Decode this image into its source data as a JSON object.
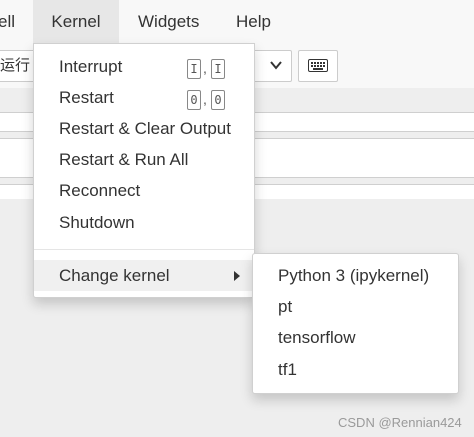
{
  "menubar": {
    "items": [
      {
        "label": "ell"
      },
      {
        "label": "Kernel"
      },
      {
        "label": "Widgets"
      },
      {
        "label": "Help"
      }
    ]
  },
  "toolbar": {
    "run_label": "运行",
    "keyboard_icon": "keyboard-icon",
    "chevron_icon": "chevron-down-icon"
  },
  "kernel_menu": {
    "interrupt": {
      "label": "Interrupt",
      "shortcut": [
        "I",
        "I"
      ]
    },
    "restart": {
      "label": "Restart",
      "shortcut": [
        "0",
        "0"
      ]
    },
    "restart_clear": {
      "label": "Restart & Clear Output"
    },
    "restart_run_all": {
      "label": "Restart & Run All"
    },
    "reconnect": {
      "label": "Reconnect"
    },
    "shutdown": {
      "label": "Shutdown"
    },
    "change_kernel": {
      "label": "Change kernel"
    }
  },
  "kernels": [
    {
      "label": "Python 3 (ipykernel)"
    },
    {
      "label": "pt"
    },
    {
      "label": "tensorflow"
    },
    {
      "label": "tf1"
    }
  ],
  "watermark": "CSDN @Rennian424",
  "colors": {
    "menubar_bg": "#f8f8f8",
    "open_menu_bg": "#e7e7e7",
    "hover_bg": "#f0f0f0",
    "page_bg": "#eeeeee"
  }
}
